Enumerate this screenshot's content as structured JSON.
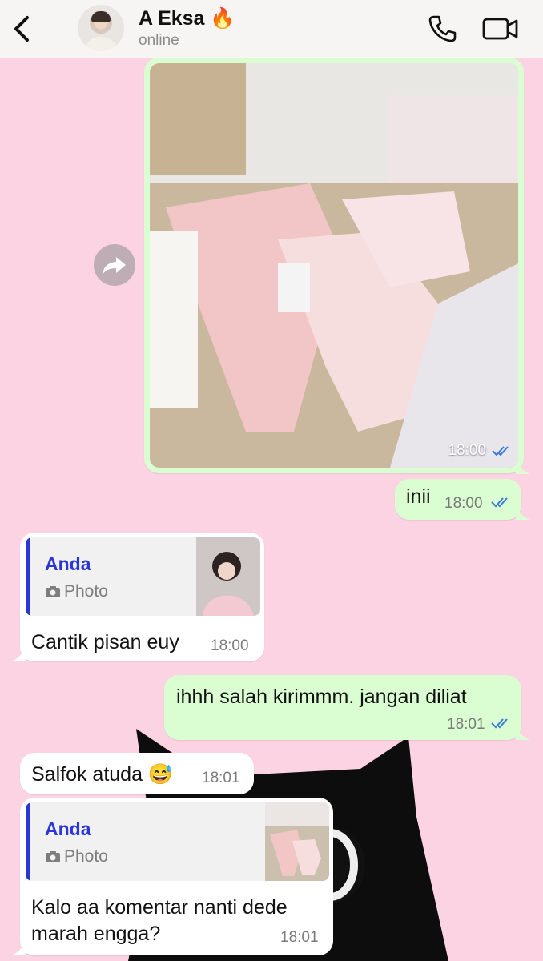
{
  "header": {
    "contact_name": "A Eksa 🔥",
    "status": "online"
  },
  "icons": {
    "back": "chevron-left-icon",
    "phone": "phone-icon",
    "video": "video-camera-icon",
    "forward": "forward-arrow-icon",
    "camera": "camera-icon",
    "read_ticks": "double-check-icon"
  },
  "colors": {
    "chat_background": "#fbd3e3",
    "outgoing_bubble": "#dafdd2",
    "incoming_bubble": "#ffffff",
    "quote_accent": "#2a36d8",
    "read_ticks": "#3a7bd5"
  },
  "messages": [
    {
      "type": "photo",
      "direction": "out",
      "time": "18:00",
      "read": true
    },
    {
      "type": "text",
      "direction": "out",
      "text": "inii",
      "time": "18:00",
      "read": true
    },
    {
      "type": "reply",
      "direction": "in",
      "quote_author": "Anda",
      "quote_label": "Photo",
      "text": "Cantik pisan euy",
      "time": "18:00"
    },
    {
      "type": "text",
      "direction": "out",
      "text": "ihhh salah kirimmm. jangan diliat",
      "time": "18:01",
      "read": true
    },
    {
      "type": "text",
      "direction": "in",
      "text": "Salfok atuda 😅",
      "time": "18:01"
    },
    {
      "type": "reply",
      "direction": "in",
      "quote_author": "Anda",
      "quote_label": "Photo",
      "text_line1": "Kalo aa komentar nanti dede",
      "text_line2": "marah engga?",
      "time": "18:01"
    }
  ]
}
